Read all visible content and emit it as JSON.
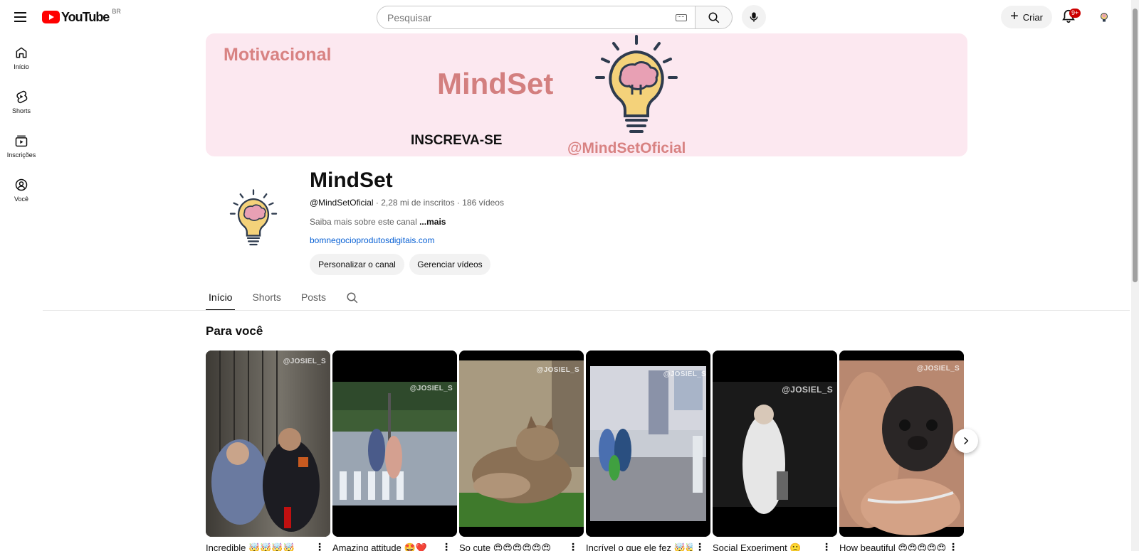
{
  "header": {
    "logo_text": "YouTube",
    "region": "BR",
    "search_placeholder": "Pesquisar",
    "create_label": "Criar",
    "notifications_badge": "9+"
  },
  "sidebar": {
    "items": [
      {
        "label": "Início",
        "icon": "home-icon"
      },
      {
        "label": "Shorts",
        "icon": "shorts-icon"
      },
      {
        "label": "Inscrições",
        "icon": "subscriptions-icon"
      },
      {
        "label": "Você",
        "icon": "you-icon"
      }
    ]
  },
  "banner": {
    "motivacional": "Motivacional",
    "mindset": "MindSet",
    "inscreva": "INSCREVA-SE",
    "handle": "@MindSetOficial"
  },
  "channel": {
    "name": "MindSet",
    "handle": "@MindSetOficial",
    "stats": " · 2,28 mi de inscritos · 186 vídeos",
    "description": "Saiba mais sobre este canal ",
    "more": "...mais",
    "link": "bomnegocioprodutosdigitais.com",
    "customize_label": "Personalizar o canal",
    "manage_label": "Gerenciar vídeos"
  },
  "tabs": [
    {
      "label": "Início",
      "active": true
    },
    {
      "label": "Shorts",
      "active": false
    },
    {
      "label": "Posts",
      "active": false
    }
  ],
  "section": {
    "title": "Para você"
  },
  "shorts": [
    {
      "title": "Incredible 🤯🤯🤯🤯",
      "watermark": "@JOSIEL_S"
    },
    {
      "title": "Amazing attitude 🤩❤️",
      "watermark": "@JOSIEL_S"
    },
    {
      "title": "So cute 😍😍😍😍😍😍",
      "watermark": "@JOSIEL_S"
    },
    {
      "title": "Incrível o que ele fez 🤯🤯🤯",
      "watermark": "@JOSIEL_S"
    },
    {
      "title": "Social Experiment 🙁",
      "watermark": "@JOSIEL_S"
    },
    {
      "title": "How beautiful 😍😍😍😍😍😍",
      "watermark": "@JOSIEL_S"
    }
  ],
  "colors": {
    "brand_red": "#ff0000",
    "banner_bg": "#fce8f0",
    "banner_text": "#d88282",
    "link": "#065fd4"
  }
}
